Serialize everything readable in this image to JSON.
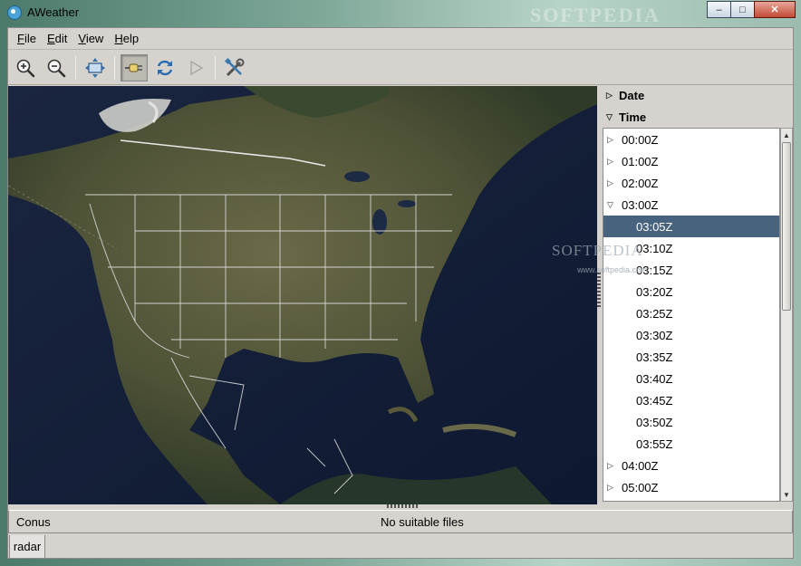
{
  "window": {
    "title": "AWeather",
    "watermark": "SOFTPEDIA",
    "buttons": {
      "minimize": "–",
      "maximize": "□",
      "close": "✕"
    }
  },
  "menu": [
    {
      "label": "File",
      "mnemonic": "F",
      "rest": "ile"
    },
    {
      "label": "Edit",
      "mnemonic": "E",
      "rest": "dit"
    },
    {
      "label": "View",
      "mnemonic": "V",
      "rest": "iew"
    },
    {
      "label": "Help",
      "mnemonic": "H",
      "rest": "elp"
    }
  ],
  "toolbar": {
    "icons": [
      "zoom-in-icon",
      "zoom-out-icon",
      "fit-view-icon",
      "plug-icon",
      "refresh-icon",
      "play-icon",
      "settings-tools-icon"
    ],
    "pressed": "plug-icon"
  },
  "sidepanel": {
    "date_header": "Date",
    "time_header": "Time",
    "time_rows": [
      {
        "label": "00:00Z",
        "kind": "parent",
        "expanded": false
      },
      {
        "label": "01:00Z",
        "kind": "parent",
        "expanded": false
      },
      {
        "label": "02:00Z",
        "kind": "parent",
        "expanded": false
      },
      {
        "label": "03:00Z",
        "kind": "parent",
        "expanded": true
      },
      {
        "label": "03:05Z",
        "kind": "child",
        "selected": true
      },
      {
        "label": "03:10Z",
        "kind": "child"
      },
      {
        "label": "03:15Z",
        "kind": "child"
      },
      {
        "label": "03:20Z",
        "kind": "child"
      },
      {
        "label": "03:25Z",
        "kind": "child"
      },
      {
        "label": "03:30Z",
        "kind": "child"
      },
      {
        "label": "03:35Z",
        "kind": "child"
      },
      {
        "label": "03:40Z",
        "kind": "child"
      },
      {
        "label": "03:45Z",
        "kind": "child"
      },
      {
        "label": "03:50Z",
        "kind": "child"
      },
      {
        "label": "03:55Z",
        "kind": "child"
      },
      {
        "label": "04:00Z",
        "kind": "parent",
        "expanded": false
      },
      {
        "label": "05:00Z",
        "kind": "parent",
        "expanded": false
      }
    ],
    "watermark": "SOFTPEDIA",
    "watermark_url": "www.softpedia.com"
  },
  "status": {
    "site": "Conus",
    "message": "No suitable files"
  },
  "tabs": [
    {
      "label": "radar"
    }
  ],
  "colors": {
    "selection": "#48637e",
    "panel": "#d6d3ce",
    "ocean": "#14223e",
    "land": "#5a5a3e"
  }
}
